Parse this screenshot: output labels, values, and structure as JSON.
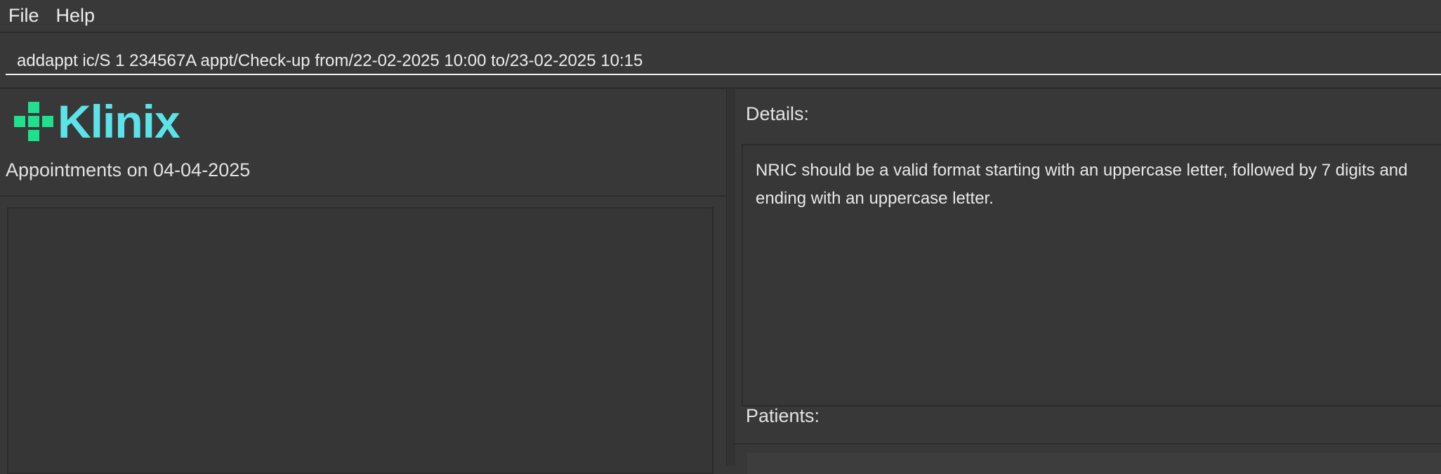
{
  "menu": {
    "file_label": "File",
    "help_label": "Help"
  },
  "command": {
    "value": "addappt ic/S 1 234567A appt/Check-up from/22-02-2025 10:00 to/23-02-2025 10:15"
  },
  "left": {
    "logo_text": "Klinix",
    "appointments_heading": "Appointments on 04-04-2025"
  },
  "right": {
    "details_label": "Details:",
    "details_text": "NRIC should be a valid format starting with an uppercase letter, followed by 7 digits and ending with an uppercase letter.",
    "patients_label": "Patients:"
  },
  "colors": {
    "background": "#383838",
    "logo_plus": "#1fe08c",
    "logo_text": "#5ce3e8"
  },
  "icons": {
    "logo_mark": "plus-cross-icon"
  }
}
